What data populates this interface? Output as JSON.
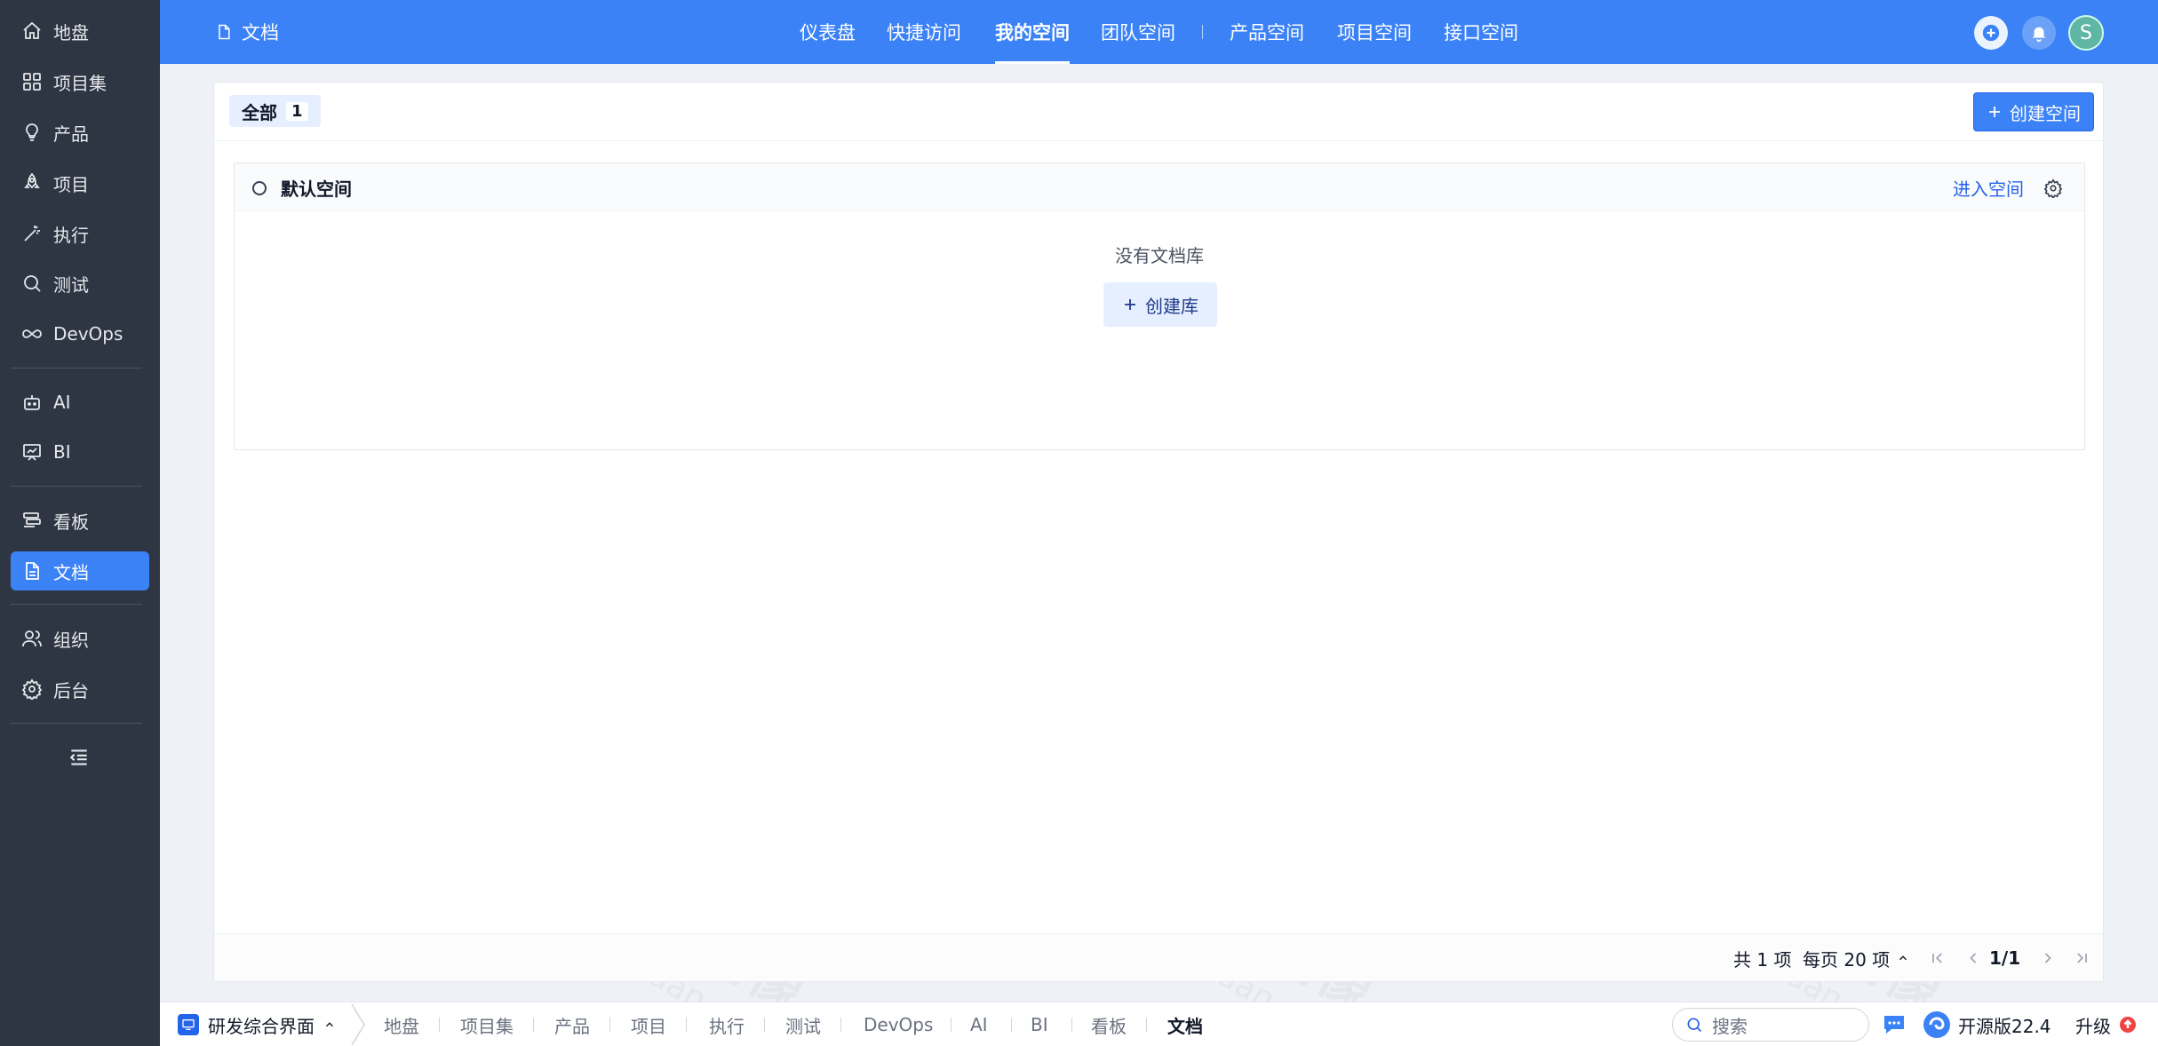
{
  "sidebar": {
    "items": [
      {
        "label": "地盘",
        "icon": "home-icon"
      },
      {
        "label": "项目集",
        "icon": "grid-icon"
      },
      {
        "label": "产品",
        "icon": "lightbulb-icon"
      },
      {
        "label": "项目",
        "icon": "rocket-icon"
      },
      {
        "label": "执行",
        "icon": "wand-icon"
      },
      {
        "label": "测试",
        "icon": "magnifier-icon"
      },
      {
        "label": "DevOps",
        "icon": "infinity-icon"
      },
      {
        "label": "AI",
        "icon": "robot-icon"
      },
      {
        "label": "BI",
        "icon": "chart-board-icon"
      },
      {
        "label": "看板",
        "icon": "kanban-icon"
      },
      {
        "label": "文档",
        "icon": "document-icon"
      },
      {
        "label": "组织",
        "icon": "users-icon"
      },
      {
        "label": "后台",
        "icon": "gear-icon"
      }
    ],
    "active_index": 10
  },
  "header": {
    "title": "文档",
    "tabs": [
      "仪表盘",
      "快捷访问",
      "我的空间",
      "团队空间",
      "产品空间",
      "项目空间",
      "接口空间"
    ],
    "active_tab": "我的空间",
    "avatar_letter": "S",
    "colors": {
      "primary": "#3b82f6"
    }
  },
  "toolbar": {
    "all_label": "全部",
    "all_count": "1",
    "create_space_label": "创建空间"
  },
  "space": {
    "name": "默认空间",
    "enter_label": "进入空间",
    "empty_text": "没有文档库",
    "create_lib_label": "创建库"
  },
  "pager": {
    "total": "共 1 项",
    "per_page": "每页 20 项",
    "page": "1/1"
  },
  "bottombar": {
    "app_switch": "研发综合界面",
    "tabs": [
      "地盘",
      "项目集",
      "产品",
      "项目",
      "执行",
      "测试",
      "DevOps",
      "AI",
      "BI",
      "看板",
      "文档"
    ],
    "active_tab": "文档",
    "search_placeholder": "搜索",
    "edition": "开源版22.4",
    "upgrade": "升级"
  },
  "watermark": {
    "cn": "轩辕镜像",
    "en": "xuanyuan.cloud"
  }
}
